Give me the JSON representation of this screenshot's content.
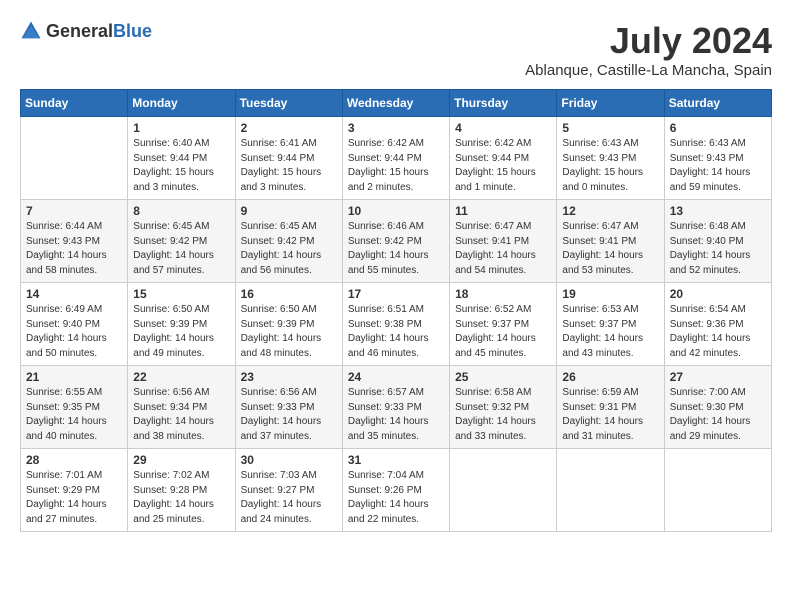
{
  "header": {
    "logo_general": "General",
    "logo_blue": "Blue",
    "month_title": "July 2024",
    "location": "Ablanque, Castille-La Mancha, Spain"
  },
  "days_of_week": [
    "Sunday",
    "Monday",
    "Tuesday",
    "Wednesday",
    "Thursday",
    "Friday",
    "Saturday"
  ],
  "weeks": [
    [
      {
        "day": "",
        "sunrise": "",
        "sunset": "",
        "daylight": ""
      },
      {
        "day": "1",
        "sunrise": "Sunrise: 6:40 AM",
        "sunset": "Sunset: 9:44 PM",
        "daylight": "Daylight: 15 hours and 3 minutes."
      },
      {
        "day": "2",
        "sunrise": "Sunrise: 6:41 AM",
        "sunset": "Sunset: 9:44 PM",
        "daylight": "Daylight: 15 hours and 3 minutes."
      },
      {
        "day": "3",
        "sunrise": "Sunrise: 6:42 AM",
        "sunset": "Sunset: 9:44 PM",
        "daylight": "Daylight: 15 hours and 2 minutes."
      },
      {
        "day": "4",
        "sunrise": "Sunrise: 6:42 AM",
        "sunset": "Sunset: 9:44 PM",
        "daylight": "Daylight: 15 hours and 1 minute."
      },
      {
        "day": "5",
        "sunrise": "Sunrise: 6:43 AM",
        "sunset": "Sunset: 9:43 PM",
        "daylight": "Daylight: 15 hours and 0 minutes."
      },
      {
        "day": "6",
        "sunrise": "Sunrise: 6:43 AM",
        "sunset": "Sunset: 9:43 PM",
        "daylight": "Daylight: 14 hours and 59 minutes."
      }
    ],
    [
      {
        "day": "7",
        "sunrise": "Sunrise: 6:44 AM",
        "sunset": "Sunset: 9:43 PM",
        "daylight": "Daylight: 14 hours and 58 minutes."
      },
      {
        "day": "8",
        "sunrise": "Sunrise: 6:45 AM",
        "sunset": "Sunset: 9:42 PM",
        "daylight": "Daylight: 14 hours and 57 minutes."
      },
      {
        "day": "9",
        "sunrise": "Sunrise: 6:45 AM",
        "sunset": "Sunset: 9:42 PM",
        "daylight": "Daylight: 14 hours and 56 minutes."
      },
      {
        "day": "10",
        "sunrise": "Sunrise: 6:46 AM",
        "sunset": "Sunset: 9:42 PM",
        "daylight": "Daylight: 14 hours and 55 minutes."
      },
      {
        "day": "11",
        "sunrise": "Sunrise: 6:47 AM",
        "sunset": "Sunset: 9:41 PM",
        "daylight": "Daylight: 14 hours and 54 minutes."
      },
      {
        "day": "12",
        "sunrise": "Sunrise: 6:47 AM",
        "sunset": "Sunset: 9:41 PM",
        "daylight": "Daylight: 14 hours and 53 minutes."
      },
      {
        "day": "13",
        "sunrise": "Sunrise: 6:48 AM",
        "sunset": "Sunset: 9:40 PM",
        "daylight": "Daylight: 14 hours and 52 minutes."
      }
    ],
    [
      {
        "day": "14",
        "sunrise": "Sunrise: 6:49 AM",
        "sunset": "Sunset: 9:40 PM",
        "daylight": "Daylight: 14 hours and 50 minutes."
      },
      {
        "day": "15",
        "sunrise": "Sunrise: 6:50 AM",
        "sunset": "Sunset: 9:39 PM",
        "daylight": "Daylight: 14 hours and 49 minutes."
      },
      {
        "day": "16",
        "sunrise": "Sunrise: 6:50 AM",
        "sunset": "Sunset: 9:39 PM",
        "daylight": "Daylight: 14 hours and 48 minutes."
      },
      {
        "day": "17",
        "sunrise": "Sunrise: 6:51 AM",
        "sunset": "Sunset: 9:38 PM",
        "daylight": "Daylight: 14 hours and 46 minutes."
      },
      {
        "day": "18",
        "sunrise": "Sunrise: 6:52 AM",
        "sunset": "Sunset: 9:37 PM",
        "daylight": "Daylight: 14 hours and 45 minutes."
      },
      {
        "day": "19",
        "sunrise": "Sunrise: 6:53 AM",
        "sunset": "Sunset: 9:37 PM",
        "daylight": "Daylight: 14 hours and 43 minutes."
      },
      {
        "day": "20",
        "sunrise": "Sunrise: 6:54 AM",
        "sunset": "Sunset: 9:36 PM",
        "daylight": "Daylight: 14 hours and 42 minutes."
      }
    ],
    [
      {
        "day": "21",
        "sunrise": "Sunrise: 6:55 AM",
        "sunset": "Sunset: 9:35 PM",
        "daylight": "Daylight: 14 hours and 40 minutes."
      },
      {
        "day": "22",
        "sunrise": "Sunrise: 6:56 AM",
        "sunset": "Sunset: 9:34 PM",
        "daylight": "Daylight: 14 hours and 38 minutes."
      },
      {
        "day": "23",
        "sunrise": "Sunrise: 6:56 AM",
        "sunset": "Sunset: 9:33 PM",
        "daylight": "Daylight: 14 hours and 37 minutes."
      },
      {
        "day": "24",
        "sunrise": "Sunrise: 6:57 AM",
        "sunset": "Sunset: 9:33 PM",
        "daylight": "Daylight: 14 hours and 35 minutes."
      },
      {
        "day": "25",
        "sunrise": "Sunrise: 6:58 AM",
        "sunset": "Sunset: 9:32 PM",
        "daylight": "Daylight: 14 hours and 33 minutes."
      },
      {
        "day": "26",
        "sunrise": "Sunrise: 6:59 AM",
        "sunset": "Sunset: 9:31 PM",
        "daylight": "Daylight: 14 hours and 31 minutes."
      },
      {
        "day": "27",
        "sunrise": "Sunrise: 7:00 AM",
        "sunset": "Sunset: 9:30 PM",
        "daylight": "Daylight: 14 hours and 29 minutes."
      }
    ],
    [
      {
        "day": "28",
        "sunrise": "Sunrise: 7:01 AM",
        "sunset": "Sunset: 9:29 PM",
        "daylight": "Daylight: 14 hours and 27 minutes."
      },
      {
        "day": "29",
        "sunrise": "Sunrise: 7:02 AM",
        "sunset": "Sunset: 9:28 PM",
        "daylight": "Daylight: 14 hours and 25 minutes."
      },
      {
        "day": "30",
        "sunrise": "Sunrise: 7:03 AM",
        "sunset": "Sunset: 9:27 PM",
        "daylight": "Daylight: 14 hours and 24 minutes."
      },
      {
        "day": "31",
        "sunrise": "Sunrise: 7:04 AM",
        "sunset": "Sunset: 9:26 PM",
        "daylight": "Daylight: 14 hours and 22 minutes."
      },
      {
        "day": "",
        "sunrise": "",
        "sunset": "",
        "daylight": ""
      },
      {
        "day": "",
        "sunrise": "",
        "sunset": "",
        "daylight": ""
      },
      {
        "day": "",
        "sunrise": "",
        "sunset": "",
        "daylight": ""
      }
    ]
  ]
}
